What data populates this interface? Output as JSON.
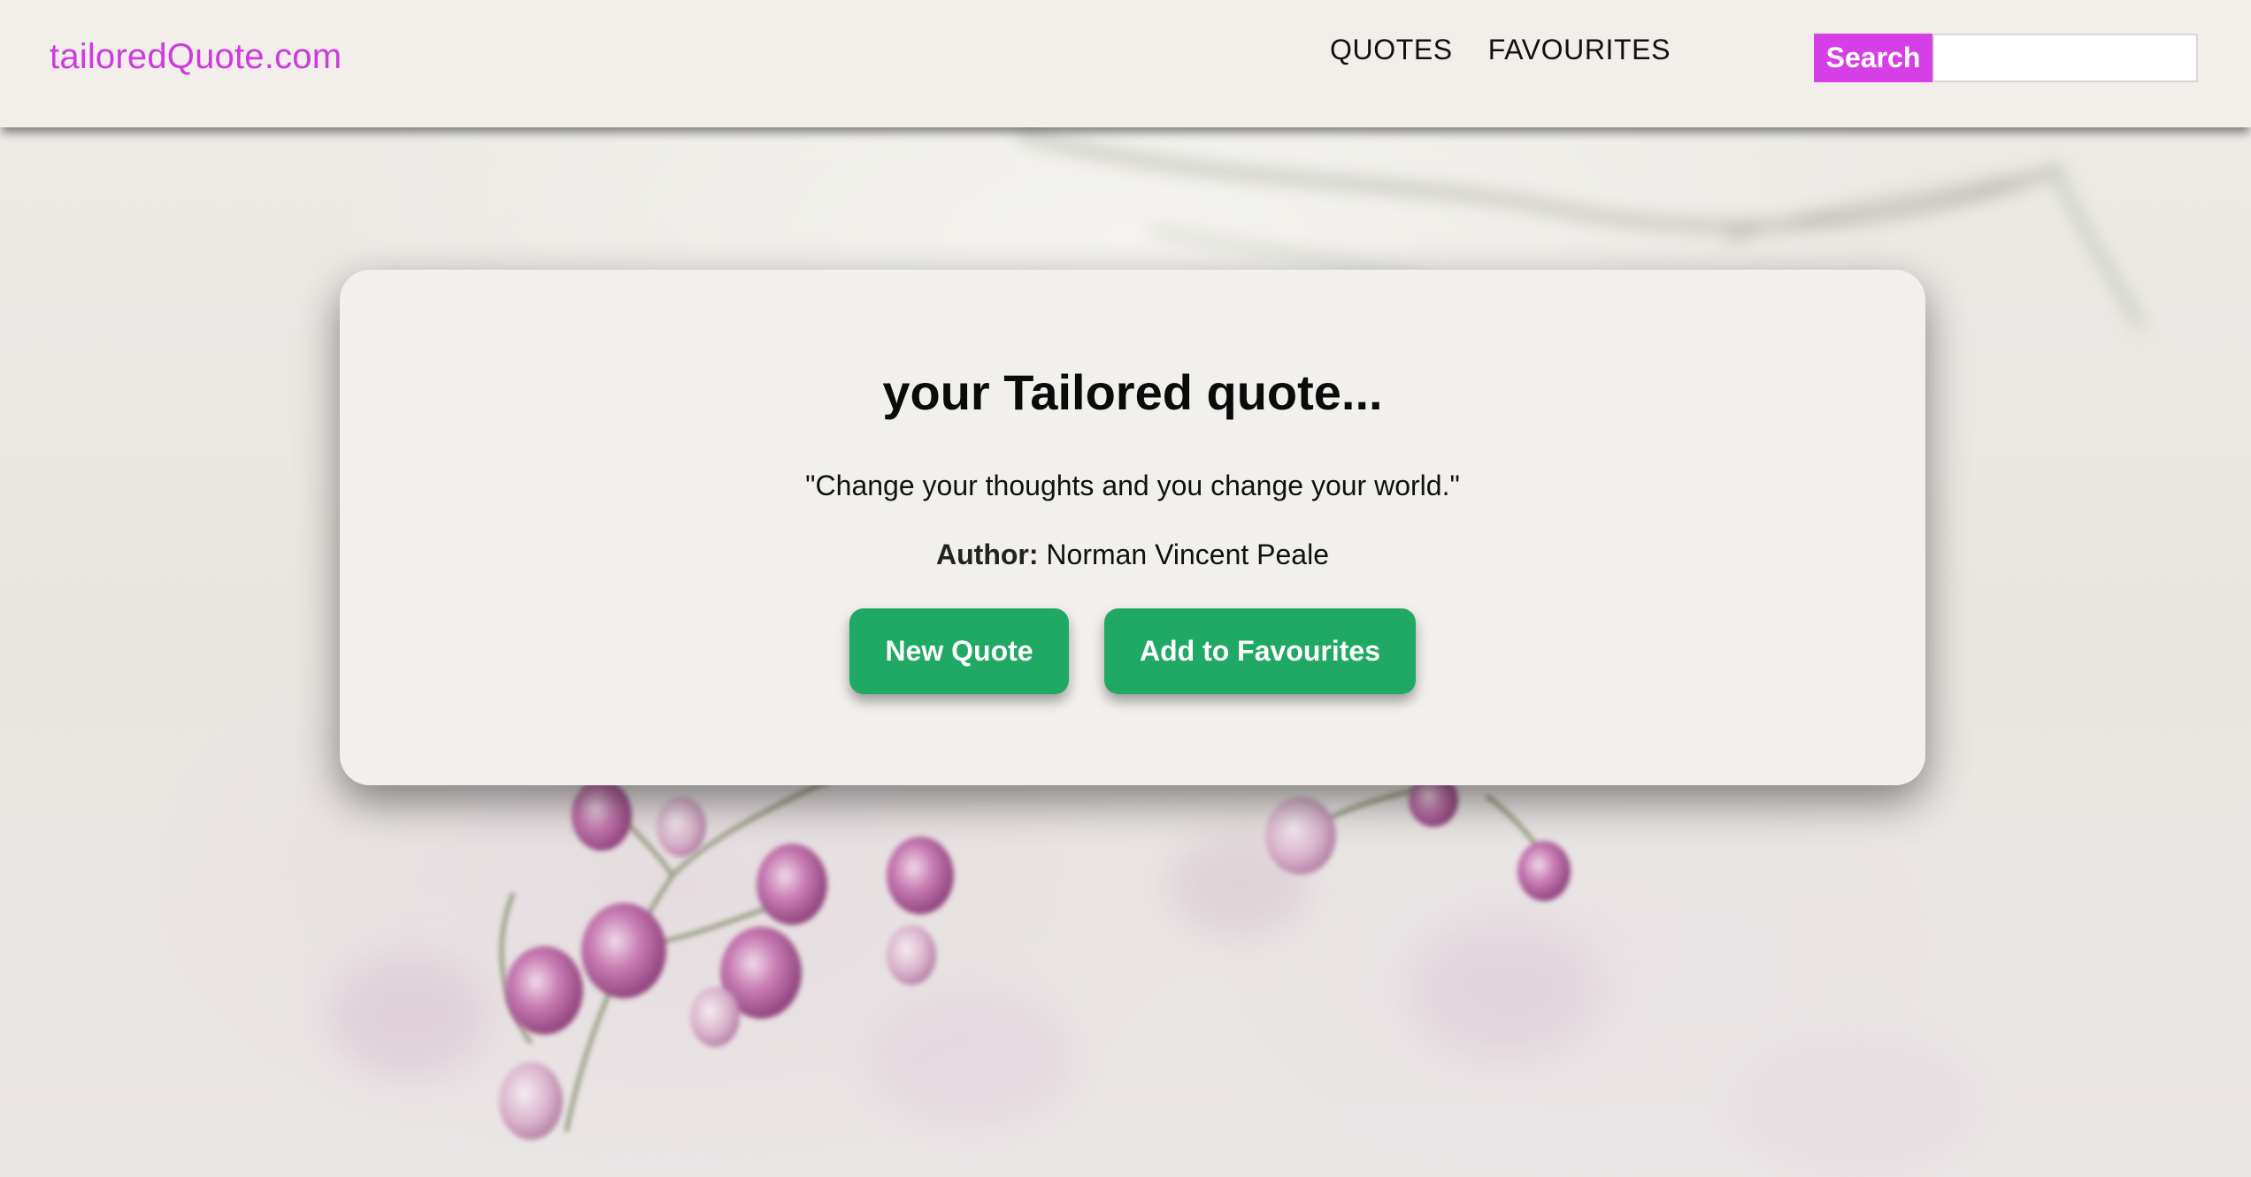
{
  "header": {
    "logo": "tailoredQuote.com",
    "nav": {
      "quotes": "QUOTES",
      "favourites": "FAVOURITES"
    },
    "search": {
      "button_label": "Search",
      "input_value": "",
      "input_placeholder": ""
    }
  },
  "card": {
    "title": "your Tailored quote...",
    "quote": "\"Change your thoughts and you change your world.\"",
    "author_label": "Author:",
    "author_name": "Norman Vincent Peale",
    "buttons": {
      "new_quote": "New Quote",
      "add_favourite": "Add to Favourites"
    }
  },
  "colors": {
    "brand_magenta": "#cf3ae0",
    "search_button": "#d63fe6",
    "action_green": "#20a865",
    "header_bg": "#f2eee9",
    "card_bg": "#f2f0ed"
  },
  "background": {
    "description_icon": "blossom-branch-image"
  }
}
